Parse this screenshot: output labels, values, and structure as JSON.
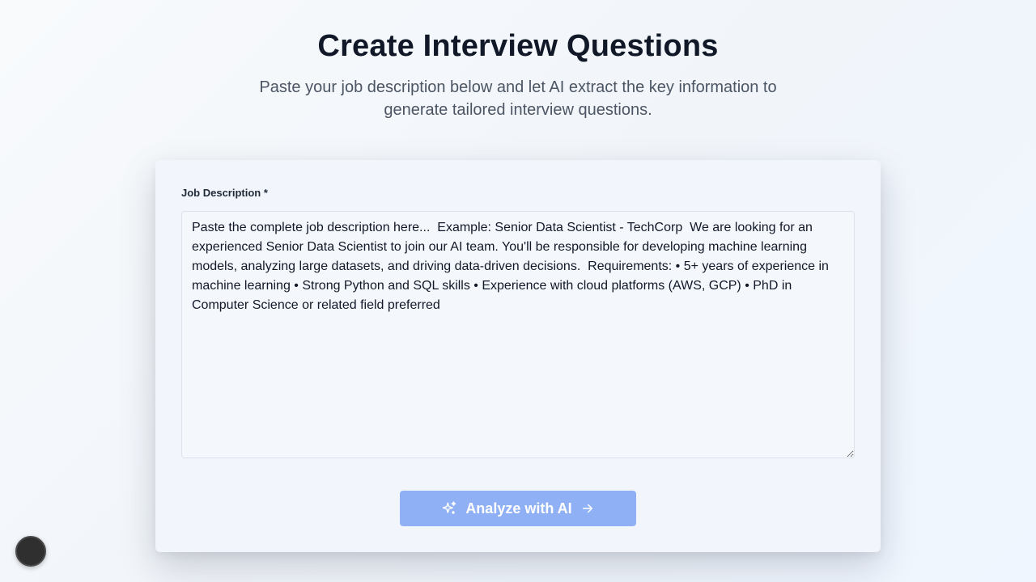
{
  "header": {
    "title": "Create Interview Questions",
    "subtitle": "Paste your job description below and let AI extract the key information to generate tailored interview questions."
  },
  "form": {
    "job_description_label": "Job Description *",
    "job_description_placeholder": "Paste the complete job description here...  Example: Senior Data Scientist - TechCorp  We are looking for an experienced Senior Data Scientist to join our AI team. You'll be responsible for developing machine learning models, analyzing large datasets, and driving data-driven decisions.  Requirements: • 5+ years of experience in machine learning • Strong Python and SQL skills • Experience with cloud platforms (AWS, GCP) • PhD in Computer Science or related field preferred",
    "job_description_value": "",
    "analyze_button_label": "Analyze with AI",
    "analyze_button_enabled": false
  },
  "colors": {
    "accent_button_disabled": "#8fb0f4",
    "title_text": "#111827",
    "subtitle_text": "#4b5563",
    "fab_background": "#2f2f2f"
  },
  "icons": {
    "analyze_leading": "sparkles-icon",
    "analyze_trailing": "arrow-right-icon"
  }
}
